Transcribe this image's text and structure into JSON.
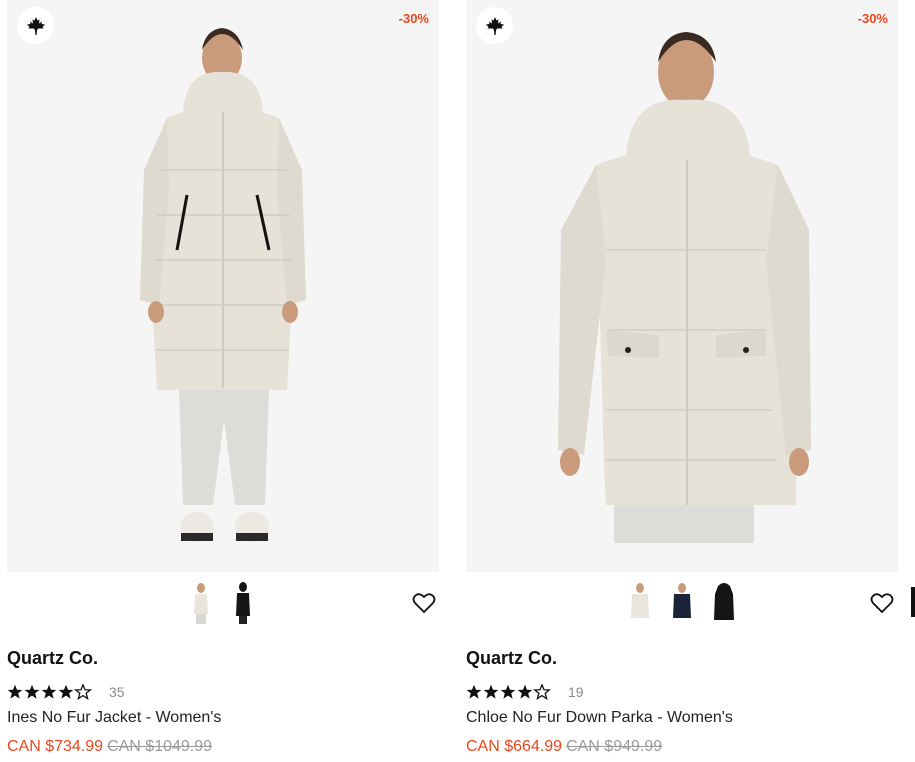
{
  "products": [
    {
      "badge": "-30%",
      "brand": "Quartz Co.",
      "rating": 4.5,
      "review_count": "35",
      "name": "Ines No Fur Jacket - Women's",
      "sale_price": "CAN $734.99",
      "original_price": "CAN $1049.99",
      "swatch_colors": [
        "#e9e5dc",
        "#151515"
      ]
    },
    {
      "badge": "-30%",
      "brand": "Quartz Co.",
      "rating": 4.5,
      "review_count": "19",
      "name": "Chloe No Fur Down Parka - Women's",
      "sale_price": "CAN $664.99",
      "original_price": "CAN $949.99",
      "swatch_colors": [
        "#e9e5dc",
        "#1b2338",
        "#151515"
      ]
    }
  ],
  "colors": {
    "sale": "#e8471d",
    "coat": "#e6e2d8",
    "background": "#f5f5f5"
  }
}
